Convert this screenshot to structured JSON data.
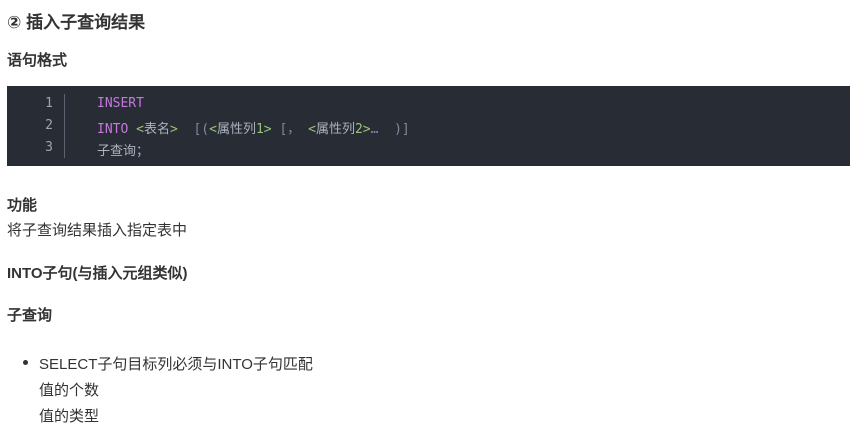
{
  "title": "② 插入子查询结果",
  "syntax_heading": "语句格式",
  "code": {
    "line_numbers": [
      "1",
      "2",
      "3"
    ],
    "line1": "INSERT",
    "line2": {
      "kw": "INTO",
      "lt1": "<",
      "table": "表名",
      "gt1": ">",
      "open": "  [(",
      "lt2": "<",
      "attr1": "属性列",
      "n1": "1",
      "gt2": ">",
      "mid": " [，",
      "lt3": "<",
      "attr2": "属性列",
      "n2": "2",
      "gt3": ">",
      "end": "…  )]"
    },
    "line3": "子查询；"
  },
  "function_heading": "功能",
  "function_text": "将子查询结果插入指定表中",
  "into_heading": "INTO子句(与插入元组类似)",
  "subquery_heading": "子查询",
  "bullet": {
    "main": "SELECT子句目标列必须与INTO子句匹配",
    "sub1": "值的个数",
    "sub2": "值的类型"
  }
}
